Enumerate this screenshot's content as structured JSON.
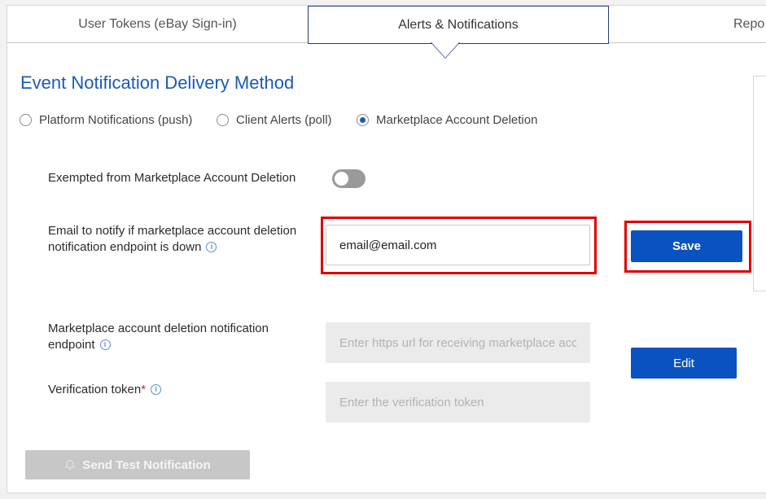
{
  "tabs": [
    {
      "label": "User Tokens (eBay Sign-in)",
      "active": false
    },
    {
      "label": "Alerts & Notifications",
      "active": true
    },
    {
      "label": "Repo",
      "active": false
    }
  ],
  "section_title": "Event Notification Delivery Method",
  "delivery_methods": [
    {
      "label": "Platform Notifications (push)",
      "checked": false
    },
    {
      "label": "Client Alerts (poll)",
      "checked": false
    },
    {
      "label": "Marketplace Account Deletion",
      "checked": true
    }
  ],
  "exempted": {
    "label": "Exempted from Marketplace Account Deletion",
    "enabled": false
  },
  "email": {
    "label_line1": "Email to notify if marketplace account deletion",
    "label_line2": "notification endpoint is down",
    "value": "email@email.com"
  },
  "save_label": "Save",
  "endpoint": {
    "label_line1": "Marketplace account deletion notification",
    "label_line2": "endpoint",
    "placeholder": "Enter https url for receiving marketplace account deletion notifications"
  },
  "token": {
    "label": "Verification token",
    "required_mark": "*",
    "placeholder": "Enter the verification token"
  },
  "edit_label": "Edit",
  "send_test_label": "Send Test Notification",
  "colors": {
    "accent": "#0a52bf",
    "title": "#1a5bb5",
    "highlight": "#e00000"
  }
}
